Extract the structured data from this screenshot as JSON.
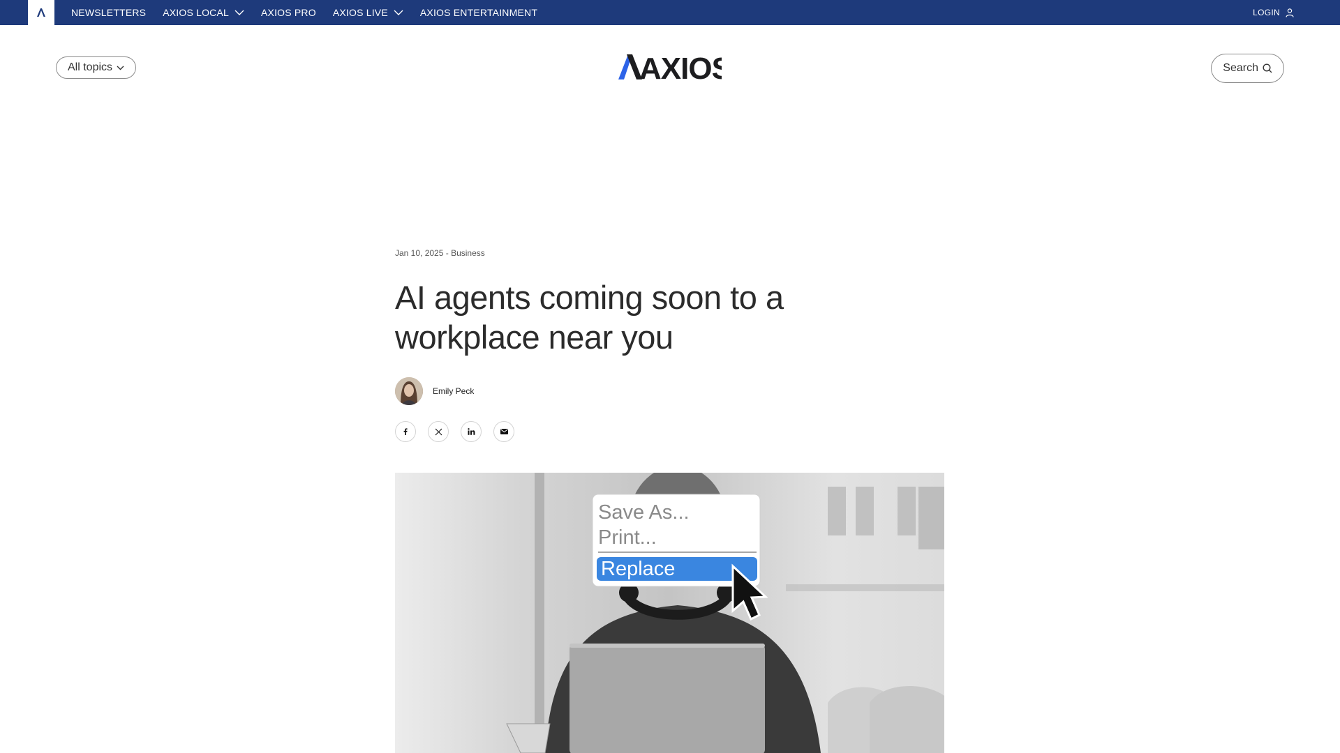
{
  "topbar": {
    "nav": [
      {
        "label": "NEWSLETTERS",
        "has_dropdown": false
      },
      {
        "label": "AXIOS LOCAL",
        "has_dropdown": true
      },
      {
        "label": "AXIOS PRO",
        "has_dropdown": false
      },
      {
        "label": "AXIOS LIVE",
        "has_dropdown": true
      },
      {
        "label": "AXIOS ENTERTAINMENT",
        "has_dropdown": false
      }
    ],
    "login_label": "LOGIN",
    "bg_color": "#1e3a7b"
  },
  "header": {
    "topics_label": "All topics",
    "logo_text": "AXIOS",
    "search_label": "Search"
  },
  "article": {
    "date": "Jan 10, 2025",
    "separator": " - ",
    "category": "Business",
    "headline": "AI agents coming soon to a workplace near you",
    "author": "Emily Peck",
    "share_icons": [
      "facebook-icon",
      "x-icon",
      "linkedin-icon",
      "email-icon"
    ]
  },
  "hero": {
    "menu": {
      "items": [
        "Save As...",
        "Print..."
      ],
      "selected": "Replace",
      "accent": "#3a86e0"
    }
  }
}
